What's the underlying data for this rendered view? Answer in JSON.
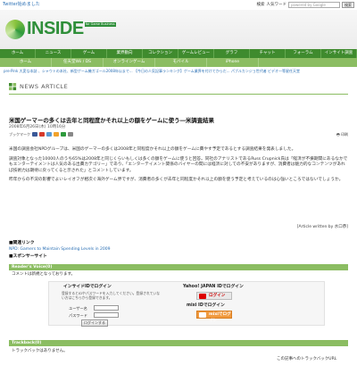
{
  "topbar": {
    "twitter_link": "Twitter始めました",
    "search_hint": "検索",
    "search_mode": "人気ワード",
    "search_placeholder": "powered by Google",
    "search_button": "検索"
  },
  "logo": {
    "word": "INSIDE",
    "badge": "for Game Business"
  },
  "nav_primary": [
    "ホーム",
    "ニュース",
    "ゲーム",
    "業界動向",
    "コレクション",
    "ゲームレビュー",
    "グラフ",
    "チャット",
    "フォーラム",
    "インサイト調査"
  ],
  "nav_secondary": [
    "ホーム",
    "任天堂Wii / DS",
    "オンラインゲーム",
    "モバイル",
    "iPhone"
  ],
  "ticker": "pre-Pink 大変な本誌 、シャウトの本社、新型ゲーム機ガゴール2008年以まで... 【今日の人気記事ランキング】ゲーム業界を付けてからだ... パブルカンジョ世代者 ビデオ一等星任天堂",
  "article": {
    "section_label": "NEWS ARTICLE",
    "title": "米国ゲーマーの多くは去年と同程度かそれ以上の額をゲームに使う―米調査結果",
    "date": "2008年6月26日(木) 10時16分",
    "share_label": "ブックマーク",
    "print_label": "印刷",
    "paragraphs": [
      "米国の調査会社NPDグループは、米国のゲーマーの多くは2008年と同程度かそれ以上の額をゲームに費やす予定であるとする調査結果を発表しました。",
      "調査対象となった10000人のうち65%は2008年と同じくらいもしくは多くの額をゲームに使うと回答。同社のアナリストであるRuss Crupnick氏は「経済が不振期間にあるなかでもエンターテイメントは人気のある出費カテゴリー」であり、「エンターテイメント関係のバイヤーの間には経済に対しての不安がありますが、消費者は魅力的なコンテンツがあれば技術力は期待に戻ってくると示された」とコメントしています。",
      "昨年からの不況の影響でよいレイオフが相次ぐ海外ゲーム界ですが、消費者の多くが去年と同程度かそれ以上の額を使う予定と考えているのは心強いところではないでしょうか。"
    ],
    "byline": "[Article written by 水口恭]"
  },
  "related": {
    "heading": "■関連リンク",
    "link": "NPD: Gamers to Maintain Spending Levels in 2009"
  },
  "sponsor": {
    "heading": "■スポンサーサイト"
  },
  "comments": {
    "bar": "Reader's Voice(0)",
    "empty": "コメントは新規となっております。",
    "login": {
      "inside_title": "インサイドIDでログイン",
      "inside_note": "登録するとIDやパスワードを入力してください。登録されていない方はこちらから登録できます。",
      "user_label": "ユーザー名",
      "pass_label": "パスワード",
      "login_button": "ログインする",
      "yahoo_title": "Yahoo! JAPAN IDでログイン",
      "yahoo_button": "ログイン",
      "mixi_title": "mixi IDでログイン",
      "mixi_button": "mixiでログイン"
    }
  },
  "trackback": {
    "bar": "Trackback(0)",
    "empty": "トラックバックはありません。",
    "url_label": "この記事へのトラックバックURL"
  }
}
